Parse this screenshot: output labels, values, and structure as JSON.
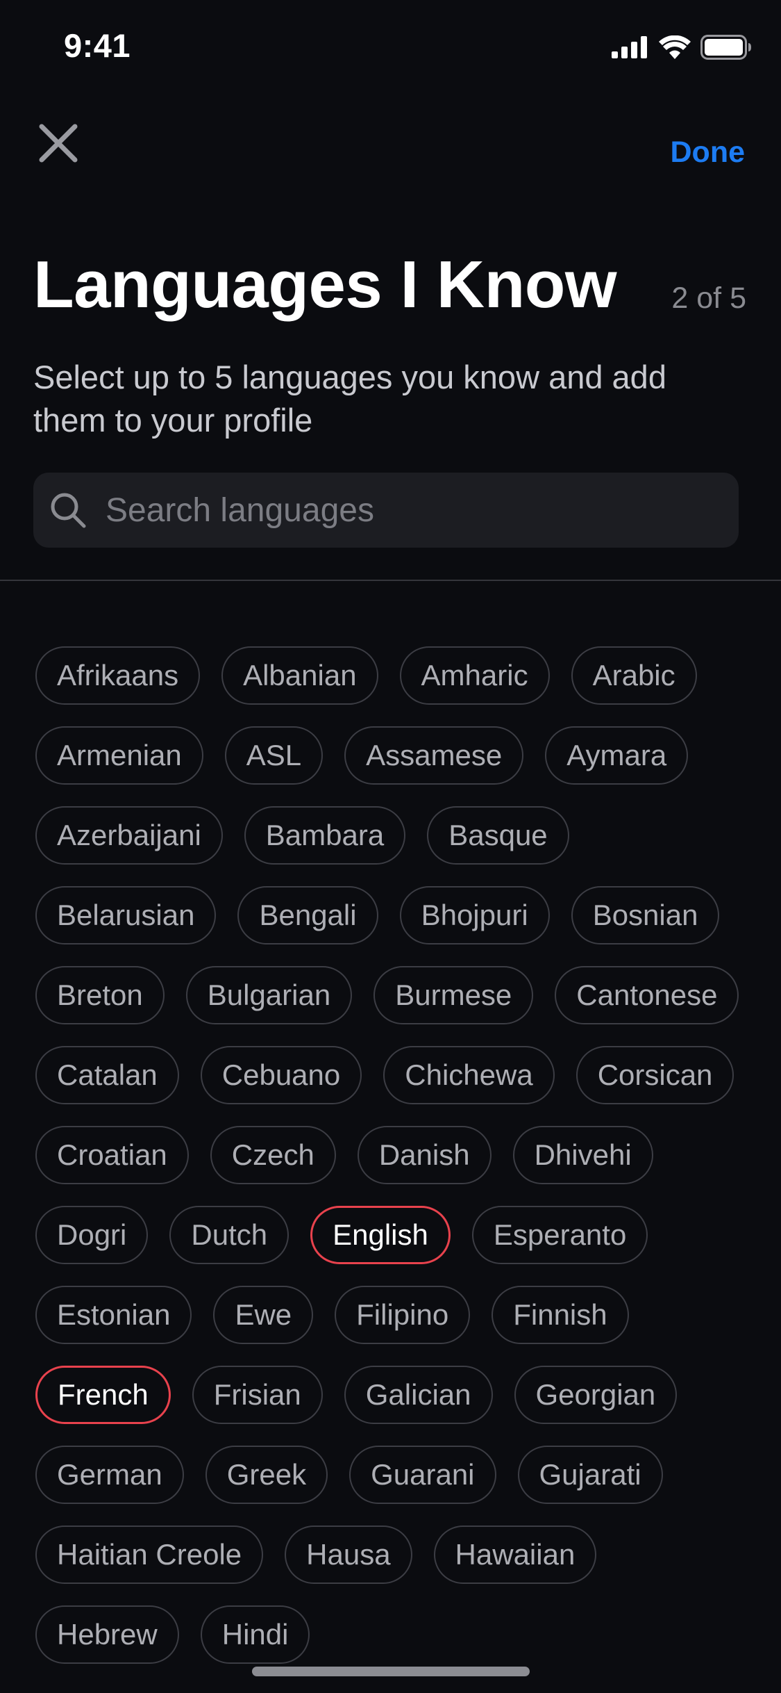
{
  "status_bar": {
    "time": "9:41",
    "icons": [
      "cellular-signal-icon",
      "wifi-icon",
      "battery-icon"
    ]
  },
  "header": {
    "close_icon": "close-icon",
    "done_label": "Done",
    "title": "Languages I Know",
    "counter": "2 of 5",
    "subtitle": "Select up to 5 languages you know and add them to your profile"
  },
  "search": {
    "icon": "search-icon",
    "placeholder": "Search languages"
  },
  "colors": {
    "background": "#0b0c10",
    "accent_blue": "#1d7cf2",
    "selected_border": "#e8424d",
    "chip_border": "#3c3d44"
  },
  "languages": [
    {
      "label": "Afrikaans",
      "selected": false
    },
    {
      "label": "Albanian",
      "selected": false
    },
    {
      "label": "Amharic",
      "selected": false
    },
    {
      "label": "Arabic",
      "selected": false
    },
    {
      "label": "Armenian",
      "selected": false
    },
    {
      "label": "ASL",
      "selected": false
    },
    {
      "label": "Assamese",
      "selected": false
    },
    {
      "label": "Aymara",
      "selected": false
    },
    {
      "label": "Azerbaijani",
      "selected": false
    },
    {
      "label": "Bambara",
      "selected": false
    },
    {
      "label": "Basque",
      "selected": false
    },
    {
      "label": "Belarusian",
      "selected": false
    },
    {
      "label": "Bengali",
      "selected": false
    },
    {
      "label": "Bhojpuri",
      "selected": false
    },
    {
      "label": "Bosnian",
      "selected": false
    },
    {
      "label": "Breton",
      "selected": false
    },
    {
      "label": "Bulgarian",
      "selected": false
    },
    {
      "label": "Burmese",
      "selected": false
    },
    {
      "label": "Cantonese",
      "selected": false
    },
    {
      "label": "Catalan",
      "selected": false
    },
    {
      "label": "Cebuano",
      "selected": false
    },
    {
      "label": "Chichewa",
      "selected": false
    },
    {
      "label": "Corsican",
      "selected": false
    },
    {
      "label": "Croatian",
      "selected": false
    },
    {
      "label": "Czech",
      "selected": false
    },
    {
      "label": "Danish",
      "selected": false
    },
    {
      "label": "Dhivehi",
      "selected": false
    },
    {
      "label": "Dogri",
      "selected": false
    },
    {
      "label": "Dutch",
      "selected": false
    },
    {
      "label": "English",
      "selected": true
    },
    {
      "label": "Esperanto",
      "selected": false
    },
    {
      "label": "Estonian",
      "selected": false
    },
    {
      "label": "Ewe",
      "selected": false
    },
    {
      "label": "Filipino",
      "selected": false
    },
    {
      "label": "Finnish",
      "selected": false
    },
    {
      "label": "French",
      "selected": true
    },
    {
      "label": "Frisian",
      "selected": false
    },
    {
      "label": "Galician",
      "selected": false
    },
    {
      "label": "Georgian",
      "selected": false
    },
    {
      "label": "German",
      "selected": false
    },
    {
      "label": "Greek",
      "selected": false
    },
    {
      "label": "Guarani",
      "selected": false
    },
    {
      "label": "Gujarati",
      "selected": false
    },
    {
      "label": "Haitian Creole",
      "selected": false
    },
    {
      "label": "Hausa",
      "selected": false
    },
    {
      "label": "Hawaiian",
      "selected": false
    },
    {
      "label": "Hebrew",
      "selected": false
    },
    {
      "label": "Hindi",
      "selected": false
    }
  ]
}
